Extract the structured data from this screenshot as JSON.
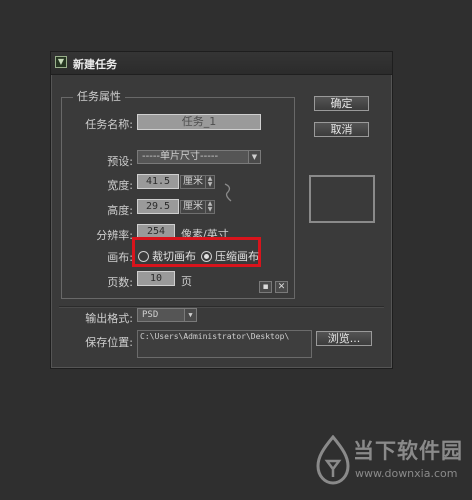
{
  "dialog": {
    "title": "新建任务",
    "group_title": "任务属性",
    "task_name_label": "任务名称:",
    "task_name_value": "任务_1",
    "preset_label": "预设:",
    "preset_value": "-----单片尺寸-----",
    "width_label": "宽度:",
    "width_value": "41.5",
    "width_unit": "厘米",
    "height_label": "高度:",
    "height_value": "29.5",
    "height_unit": "厘米",
    "resolution_label": "分辨率:",
    "resolution_value": "254",
    "resolution_unit": "像素/英寸",
    "canvas_label": "画布:",
    "canvas_options": [
      {
        "label": "裁切画布",
        "selected": false
      },
      {
        "label": "压缩画布",
        "selected": true
      }
    ],
    "pages_label": "页数:",
    "pages_value": "10",
    "pages_unit": "页",
    "ok_button": "确定",
    "cancel_button": "取消",
    "output_format_label": "输出格式:",
    "output_format_value": "PSD",
    "save_location_label": "保存位置:",
    "save_location_value": "C:\\Users\\Administrator\\Desktop\\",
    "browse_button": "浏览..."
  },
  "watermark": {
    "title": "当下软件园",
    "url": "www.downxia.com"
  },
  "colors": {
    "highlight_box": "#d8141c",
    "background": "#2f2f2f",
    "dialog": "#3a3a3a"
  }
}
